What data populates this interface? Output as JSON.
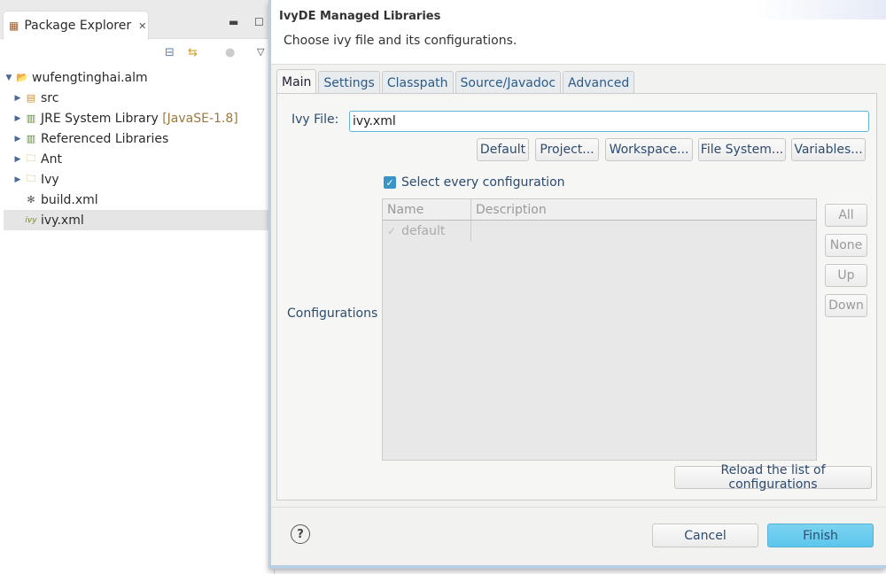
{
  "ide": {
    "view_tab": {
      "label": "Package Explorer",
      "icon": "package-explorer-icon",
      "close": "✕"
    },
    "view_controls": {
      "minimize": "▬",
      "maximize": "☐"
    },
    "toolbar": {
      "collapse_all": "⊟",
      "link_editor": "⇆",
      "focus": "●",
      "menu": "▽"
    },
    "tree": [
      {
        "label": "wufengtinghai.alm",
        "expanded": true,
        "level": 0,
        "icon": "project-icon"
      },
      {
        "label": "src",
        "level": 1,
        "icon": "package-folder-icon"
      },
      {
        "label": "JRE System Library",
        "decoration": "[JavaSE-1.8]",
        "level": 1,
        "icon": "library-icon"
      },
      {
        "label": "Referenced Libraries",
        "level": 1,
        "icon": "library-icon"
      },
      {
        "label": "Ant",
        "level": 1,
        "icon": "folder-icon"
      },
      {
        "label": "Ivy",
        "level": 1,
        "icon": "folder-icon"
      },
      {
        "label": "build.xml",
        "level": 1,
        "icon": "ant-file-icon"
      },
      {
        "label": "ivy.xml",
        "level": 1,
        "icon": "ivy-file-icon",
        "selected": true
      }
    ]
  },
  "dialog": {
    "title": "IvyDE Managed Libraries",
    "message": "Choose ivy file and its configurations.",
    "tabs": [
      "Main",
      "Settings",
      "Classpath",
      "Source/Javadoc",
      "Advanced"
    ],
    "active_tab": "Main",
    "ivy_file_label": "Ivy File:",
    "ivy_file_value": "ivy.xml",
    "file_buttons": [
      "Default",
      "Project...",
      "Workspace...",
      "File System...",
      "Variables..."
    ],
    "select_every_label": "Select every configuration",
    "select_every_checked": true,
    "configurations_label": "Configurations",
    "table": {
      "columns": [
        "Name",
        "Description"
      ],
      "rows": [
        {
          "name": "default",
          "description": "",
          "checked": true
        }
      ]
    },
    "side_buttons": [
      "All",
      "None",
      "Up",
      "Down"
    ],
    "reload_label": "Reload the list of configurations",
    "cancel_label": "Cancel",
    "finish_label": "Finish",
    "help": "?"
  }
}
